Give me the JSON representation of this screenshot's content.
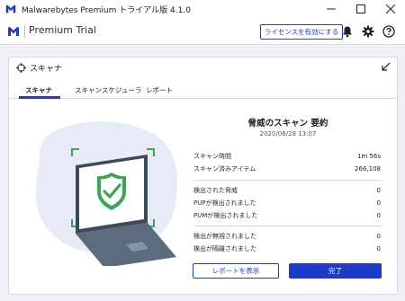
{
  "window": {
    "title": "Malwarebytes Premium トライアル版  4.1.0",
    "controls": [
      "minimize",
      "maximize",
      "close"
    ]
  },
  "header": {
    "product": "Premium Trial",
    "license_button": "ライセンスを有効にする",
    "icons": [
      "bell-icon",
      "gear-icon",
      "help-icon"
    ]
  },
  "panel": {
    "title": "スキャナ",
    "tabs": [
      {
        "label": "スキャナ",
        "active": true
      },
      {
        "label": "スキャンスケジューラ",
        "active": false
      },
      {
        "label": "レポート",
        "active": false
      }
    ]
  },
  "summary": {
    "title": "脅威のスキャン 要約",
    "date": "2020/06/28 13:07",
    "rows_time": [
      {
        "label": "スキャン時間",
        "value": "1m 56s"
      },
      {
        "label": "スキャン済みアイテム",
        "value": "266,108"
      }
    ],
    "rows_detected": [
      {
        "label": "検出された脅威",
        "value": "0"
      },
      {
        "label": "PUPが検出されました",
        "value": "0"
      },
      {
        "label": "PUMが検出されました",
        "value": "0"
      }
    ],
    "rows_actions": [
      {
        "label": "検出が無視されました",
        "value": "0"
      },
      {
        "label": "検出が隔離されました",
        "value": "0"
      }
    ]
  },
  "buttons": {
    "report": "レポートを表示",
    "done": "完了"
  },
  "colors": {
    "accent": "#1a3cc8",
    "background": "#eef0f5",
    "shield_green": "#3aa655"
  }
}
